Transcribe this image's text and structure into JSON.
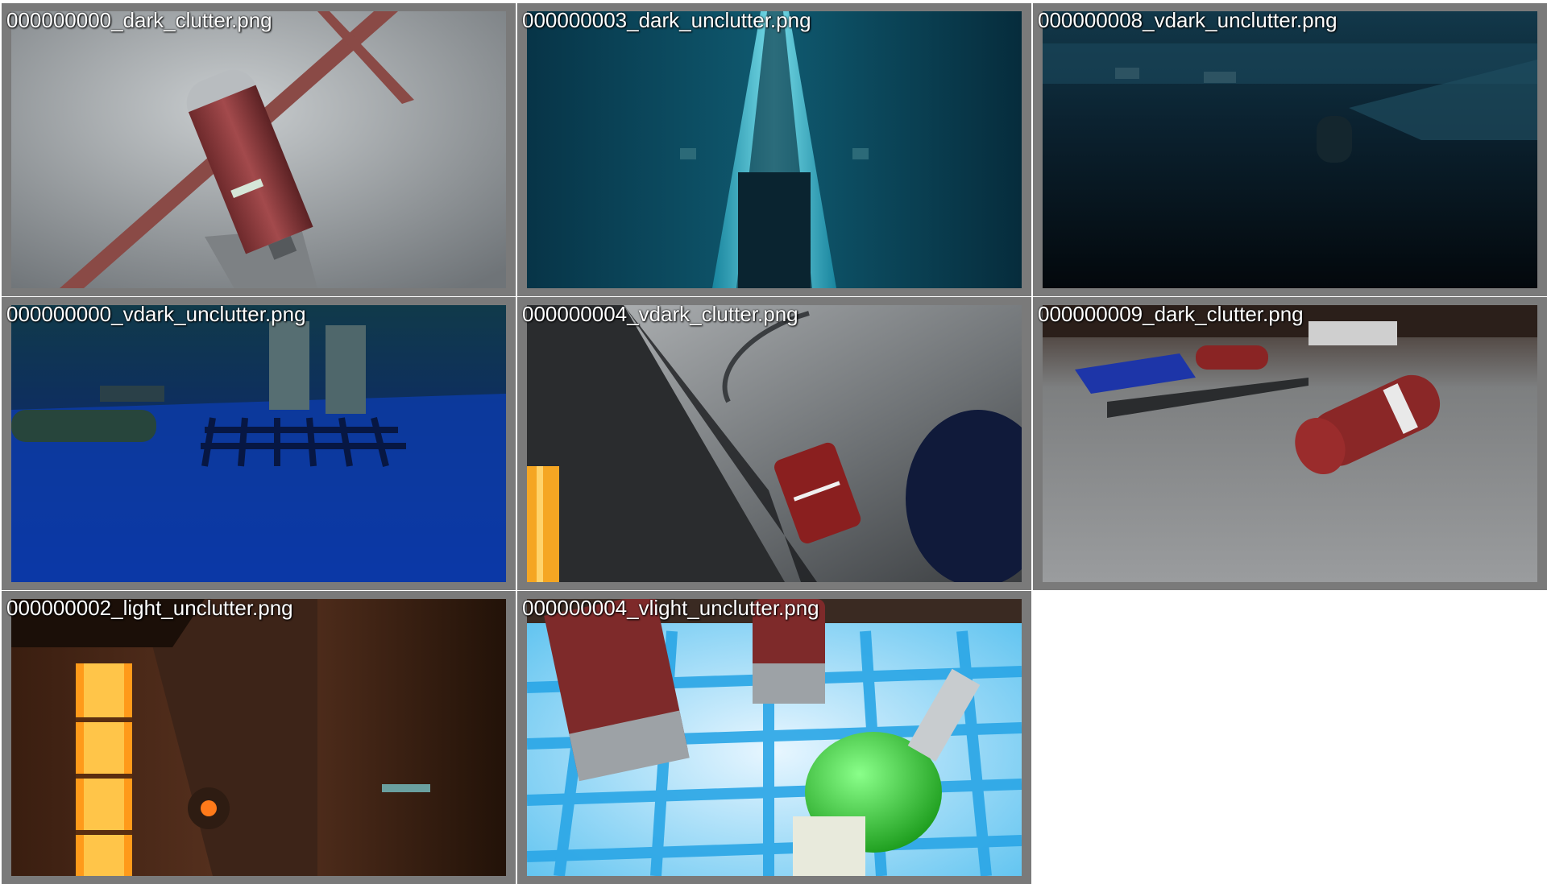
{
  "gallery": {
    "tiles": [
      {
        "filename": "000000000_dark_clutter.png"
      },
      {
        "filename": "000000003_dark_unclutter.png"
      },
      {
        "filename": "000000008_vdark_unclutter.png"
      },
      {
        "filename": "000000000_vdark_unclutter.png"
      },
      {
        "filename": "000000004_vdark_clutter.png"
      },
      {
        "filename": "000000009_dark_clutter.png"
      },
      {
        "filename": "000000002_light_unclutter.png"
      },
      {
        "filename": "000000004_vlight_unclutter.png"
      }
    ]
  }
}
